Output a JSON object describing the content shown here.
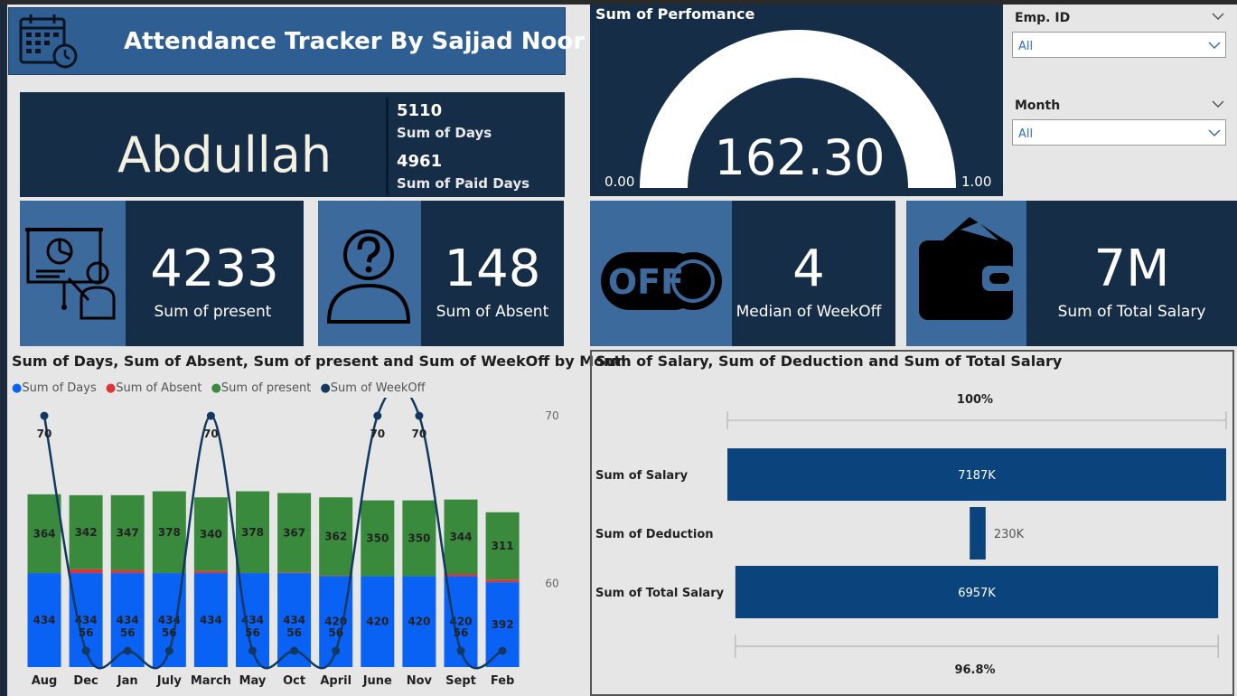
{
  "header": {
    "title": "Attendance Tracker By Sajjad Noor"
  },
  "employee": {
    "name": "Abdullah",
    "days_value": "5110",
    "days_label": "Sum of Days",
    "paid_value": "4961",
    "paid_label": "Sum of Paid Days"
  },
  "gauge": {
    "title": "Sum of Perfomance",
    "value": "162.30",
    "min": "0.00",
    "max": "1.00",
    "fill_fraction": 1.0
  },
  "slicers": [
    {
      "label": "Emp. ID",
      "value": "All"
    },
    {
      "label": "Month",
      "value": "All"
    }
  ],
  "kpis": {
    "present": {
      "value": "4233",
      "label": "Sum of present"
    },
    "absent": {
      "value": "148",
      "label": "Sum of Absent"
    },
    "weekoff": {
      "value": "4",
      "label": "Median of WeekOff",
      "icon_text": "OFF"
    },
    "salary": {
      "value": "7M",
      "label": "Sum of Total Salary"
    }
  },
  "colors": {
    "days": "#0a62f5",
    "absent": "#dc3535",
    "present": "#3a8a3e",
    "weekoff": "#12385f",
    "salary_bar": "#0b447d"
  },
  "chart_data": [
    {
      "type": "bar",
      "title": "Sum of Days, Sum of Absent, Sum of present and Sum of WeekOff by Month",
      "categories": [
        "Aug",
        "Dec",
        "Jan",
        "July",
        "March",
        "May",
        "Oct",
        "April",
        "June",
        "Nov",
        "Sept",
        "Feb"
      ],
      "series": [
        {
          "name": "Sum of Days",
          "values": [
            434,
            434,
            434,
            434,
            434,
            434,
            434,
            420,
            420,
            420,
            420,
            392
          ],
          "labels": [
            "434",
            "434",
            "434",
            "434",
            "434",
            "434",
            "434",
            "420",
            "420",
            "420",
            "420",
            "392"
          ]
        },
        {
          "name": "Sum of Absent",
          "values": [
            0,
            18,
            13,
            0,
            10,
            0,
            3,
            2,
            0,
            0,
            10,
            12
          ]
        },
        {
          "name": "Sum of present",
          "values": [
            364,
            342,
            347,
            378,
            340,
            378,
            367,
            362,
            350,
            350,
            344,
            311
          ]
        },
        {
          "name": "Sum of WeekOff",
          "values": [
            70,
            56,
            56,
            56,
            70,
            56,
            56,
            56,
            70,
            70,
            56,
            56
          ],
          "labels": [
            "70",
            "56",
            "56",
            "56",
            "70",
            "56",
            "56",
            "56",
            "70",
            "70",
            "56",
            ""
          ]
        }
      ],
      "legend": [
        "Sum of Days",
        "Sum of Absent",
        "Sum of present",
        "Sum of WeekOff"
      ],
      "secondary_axis": {
        "ticks": [
          "70",
          "60"
        ],
        "range": [
          56,
          70
        ]
      },
      "legend_position": "top-left"
    },
    {
      "type": "bar",
      "title": "Sum of Salary, Sum of Deduction and Sum of Total Salary",
      "categories": [
        "Sum of Salary",
        "Sum of Deduction",
        "Sum of Total Salary"
      ],
      "values": [
        7187,
        230,
        6957
      ],
      "value_labels": [
        "7187K",
        "230K",
        "6957K"
      ],
      "top_percent": "100%",
      "bottom_percent": "96.8%"
    }
  ]
}
